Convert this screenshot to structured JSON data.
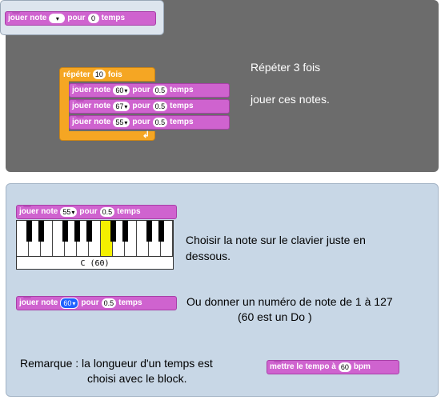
{
  "palette": {
    "block": {
      "prefix": "jouer note",
      "middle": "pour",
      "beats": "0",
      "suffix": "temps"
    }
  },
  "example": {
    "repeat": {
      "prefix": "répéter",
      "count": "10",
      "suffix": "fois"
    },
    "notes": [
      {
        "prefix": "jouer note",
        "note": "60",
        "middle": "pour",
        "beats": "0.5",
        "suffix": "temps"
      },
      {
        "prefix": "jouer note",
        "note": "67",
        "middle": "pour",
        "beats": "0.5",
        "suffix": "temps"
      },
      {
        "prefix": "jouer note",
        "note": "55",
        "middle": "pour",
        "beats": "0.5",
        "suffix": "temps"
      }
    ],
    "caption_1": "Répéter 3 fois",
    "caption_2": "jouer ces notes."
  },
  "keyboard_section": {
    "block": {
      "prefix": "jouer note",
      "note": "55",
      "middle": "pour",
      "beats": "0.5",
      "suffix": "temps"
    },
    "keyboard_label": "C (60)",
    "highlighted_white_key_index": 7,
    "text": "Choisir la note sur le clavier juste en dessous."
  },
  "number_section": {
    "block": {
      "prefix": "jouer note",
      "note": "60",
      "middle": "pour",
      "beats": "0.5",
      "suffix": "temps"
    },
    "text_1": "Ou donner un numéro de note de 1 à 127",
    "text_2": "(60 est un Do )"
  },
  "remark": {
    "text_1": "Remarque : la longueur d'un temps est",
    "text_2": "choisi avec le block.",
    "tempo_block": {
      "prefix": "mettre le tempo à",
      "value": "60",
      "suffix": "bpm"
    }
  },
  "colors": {
    "sound_block": "#cf63cf",
    "control_block": "#f5a623",
    "top_panel": "#6c6c6c",
    "bottom_panel": "#c8d7e6",
    "key_highlight": "#f4f000"
  }
}
